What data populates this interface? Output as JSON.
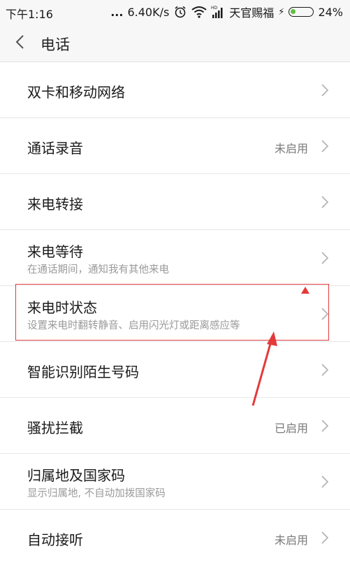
{
  "status_bar": {
    "time": "下午1:16",
    "dots": "...",
    "speed": "6.40K/s",
    "carrier": "天官赐福",
    "battery": "24%",
    "battery_level": 0.24,
    "icons": [
      "alarm-icon",
      "wifi-icon",
      "hd-signal-icon",
      "charging-icon",
      "battery-icon"
    ]
  },
  "header": {
    "title": "电话"
  },
  "settings": {
    "items": [
      {
        "label": "双卡和移动网络"
      },
      {
        "label": "通话录音",
        "value": "未启用"
      },
      {
        "label": "来电转接"
      },
      {
        "label": "来电等待",
        "subtitle": "在通话期间，通知我有其他来电"
      },
      {
        "label": "来电时状态",
        "subtitle": "设置来电时翻转静音、启用闪光灯或距离感应等"
      },
      {
        "label": "智能识别陌生号码"
      },
      {
        "label": "骚扰拦截",
        "value": "已启用"
      },
      {
        "label": "归属地及国家码",
        "subtitle": "显示归属地, 不自动加拨国家码"
      },
      {
        "label": "自动接听",
        "value": "未启用"
      }
    ]
  },
  "colors": {
    "annotation": "#e23a3a",
    "battery_fill": "#5fbf3f"
  }
}
